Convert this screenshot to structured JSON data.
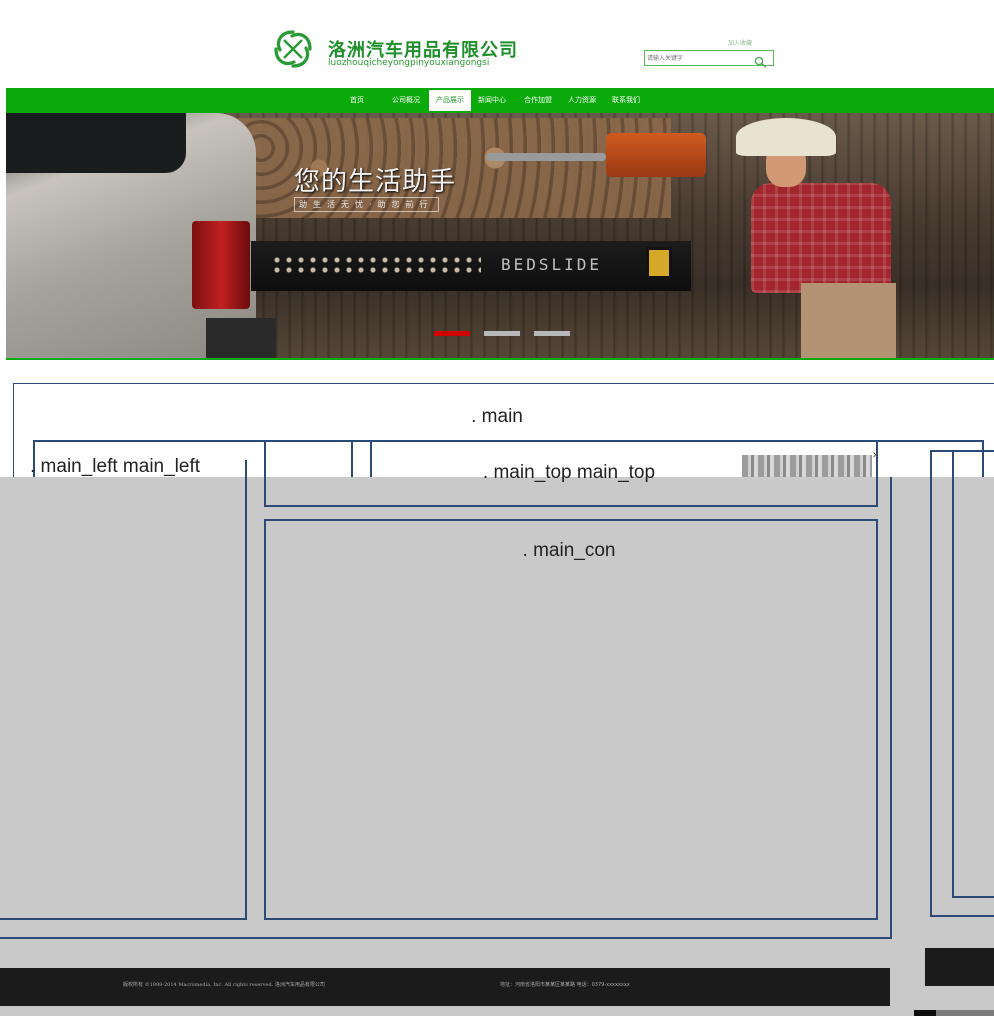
{
  "header": {
    "brand_title": "洛洲汽车用品有限公司",
    "brand_subtitle": "luozhouqicheyongpinyouxiangongsi",
    "top_link": "加入收藏",
    "search_placeholder": "请输入关键字",
    "logo_icon": "pinwheel-logo",
    "brand_color": "#1e8f2a"
  },
  "nav": {
    "color": "#0aaa0a",
    "items": [
      {
        "label": "首页"
      },
      {
        "label": "公司概况"
      },
      {
        "label": "产品展示"
      },
      {
        "label": "新闻中心"
      },
      {
        "label": "合作加盟"
      },
      {
        "label": "人力资源"
      },
      {
        "label": "联系我们"
      }
    ],
    "active_index": 2
  },
  "banner": {
    "headline": "您的生活助手",
    "subline": "助生活无忧·助您前行",
    "product_mark": "BEDSLIDE",
    "slides": 3,
    "active_slide": 0
  },
  "layout_labels": {
    "main": ". main",
    "main_left": ". main_left main_left",
    "main_top": ". main_top main_top",
    "main_con": ". main_con"
  },
  "footer": {
    "copyright": "版权所有 ©1998-2014 Macromedia, Inc. All rights reserved. 洛洲汽车用品有限公司",
    "address": "地址：河南省洛阳市某某区某某路 电话：0379-xxxxxxxx"
  }
}
